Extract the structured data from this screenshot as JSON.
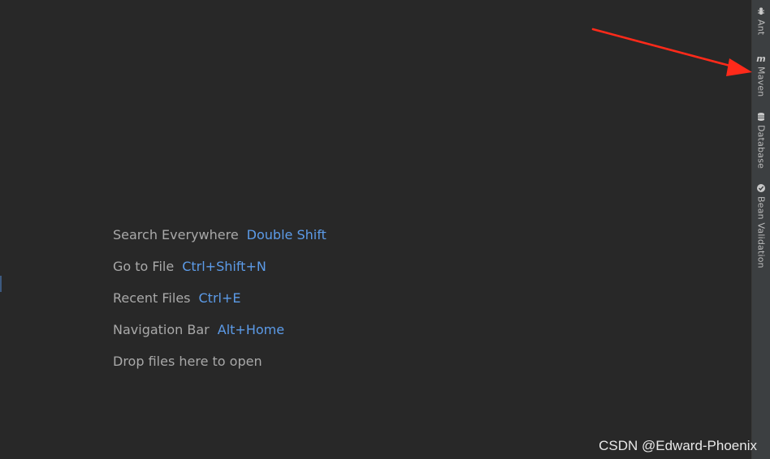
{
  "editor": {
    "hints": [
      {
        "label": "Search Everywhere",
        "shortcut": "Double Shift"
      },
      {
        "label": "Go to File",
        "shortcut": "Ctrl+Shift+N"
      },
      {
        "label": "Recent Files",
        "shortcut": "Ctrl+E"
      },
      {
        "label": "Navigation Bar",
        "shortcut": "Alt+Home"
      },
      {
        "label": "Drop files here to open",
        "shortcut": ""
      }
    ]
  },
  "tool_strip": {
    "items": [
      {
        "label": "Ant",
        "icon": "ant-icon"
      },
      {
        "label": "Maven",
        "icon": "maven-icon"
      },
      {
        "label": "Database",
        "icon": "database-icon"
      },
      {
        "label": "Bean Validation",
        "icon": "bean-validation-icon"
      }
    ]
  },
  "annotation": {
    "arrow_color": "#ff2a1a"
  },
  "watermark": "CSDN @Edward-Phoenix",
  "colors": {
    "background": "#282828",
    "hint_label": "#a9a9a9",
    "hint_shortcut": "#5c9be8",
    "tool_strip": "#3c3f41"
  }
}
